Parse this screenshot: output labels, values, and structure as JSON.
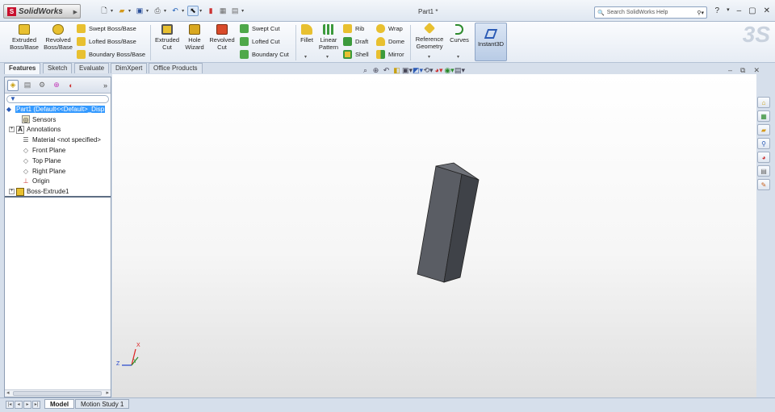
{
  "app": {
    "logo_text": "SolidWorks",
    "logo_mark": "S",
    "document_title": "Part1 *"
  },
  "quick_access": [
    {
      "name": "new-icon",
      "glyph": "🗋"
    },
    {
      "name": "open-icon",
      "glyph": "📂"
    },
    {
      "name": "save-icon",
      "glyph": "💾"
    },
    {
      "name": "print-icon",
      "glyph": "🖶"
    },
    {
      "name": "undo-icon",
      "glyph": "↶"
    },
    {
      "name": "select-icon",
      "glyph": "⬉"
    },
    {
      "name": "rebuild-icon",
      "glyph": "🚦"
    },
    {
      "name": "file-properties-icon",
      "glyph": "📋"
    },
    {
      "name": "options-icon",
      "glyph": "▤"
    }
  ],
  "search": {
    "placeholder": "Search SolidWorks Help",
    "help_label": "?"
  },
  "window_controls": {
    "minimize": "–",
    "restore": "▢",
    "close": "✕"
  },
  "command_manager": {
    "extruded_boss": "Extruded Boss/Base",
    "revolved_boss": "Revolved Boss/Base",
    "swept_boss": "Swept Boss/Base",
    "lofted_boss": "Lofted Boss/Base",
    "boundary_boss": "Boundary Boss/Base",
    "extruded_cut": "Extruded Cut",
    "hole_wizard": "Hole Wizard",
    "revolved_cut": "Revolved Cut",
    "swept_cut": "Swept Cut",
    "lofted_cut": "Lofted Cut",
    "boundary_cut": "Boundary Cut",
    "fillet": "Fillet",
    "linear_pattern": "Linear Pattern",
    "rib": "Rib",
    "draft": "Draft",
    "shell": "Shell",
    "wrap": "Wrap",
    "dome": "Dome",
    "mirror": "Mirror",
    "reference_geometry": "Reference Geometry",
    "curves": "Curves",
    "instant3d": "Instant3D"
  },
  "tabs": [
    {
      "label": "Features",
      "active": true
    },
    {
      "label": "Sketch",
      "active": false
    },
    {
      "label": "Evaluate",
      "active": false
    },
    {
      "label": "DimXpert",
      "active": false
    },
    {
      "label": "Office Products",
      "active": false
    }
  ],
  "feature_tree": {
    "root": "Part1  (Default<<Default>_Disp",
    "items": [
      {
        "label": "Sensors",
        "icon": "sensors-icon",
        "expandable": false
      },
      {
        "label": "Annotations",
        "icon": "annotations-icon",
        "expandable": true
      },
      {
        "label": "Material <not specified>",
        "icon": "material-icon",
        "expandable": false
      },
      {
        "label": "Front Plane",
        "icon": "plane-icon",
        "expandable": false
      },
      {
        "label": "Top Plane",
        "icon": "plane-icon",
        "expandable": false
      },
      {
        "label": "Right Plane",
        "icon": "plane-icon",
        "expandable": false
      },
      {
        "label": "Origin",
        "icon": "origin-icon",
        "expandable": false
      },
      {
        "label": "Boss-Extrude1",
        "icon": "extrude-icon",
        "expandable": true
      }
    ]
  },
  "triad": {
    "x": "X",
    "y": "Y",
    "z": "Z"
  },
  "bottom_tabs": [
    {
      "label": "Model",
      "active": true
    },
    {
      "label": "Motion Study 1",
      "active": false
    }
  ],
  "colors": {
    "accent": "#3399ff",
    "model_face": "#5a5d64",
    "model_side": "#3f4248"
  }
}
